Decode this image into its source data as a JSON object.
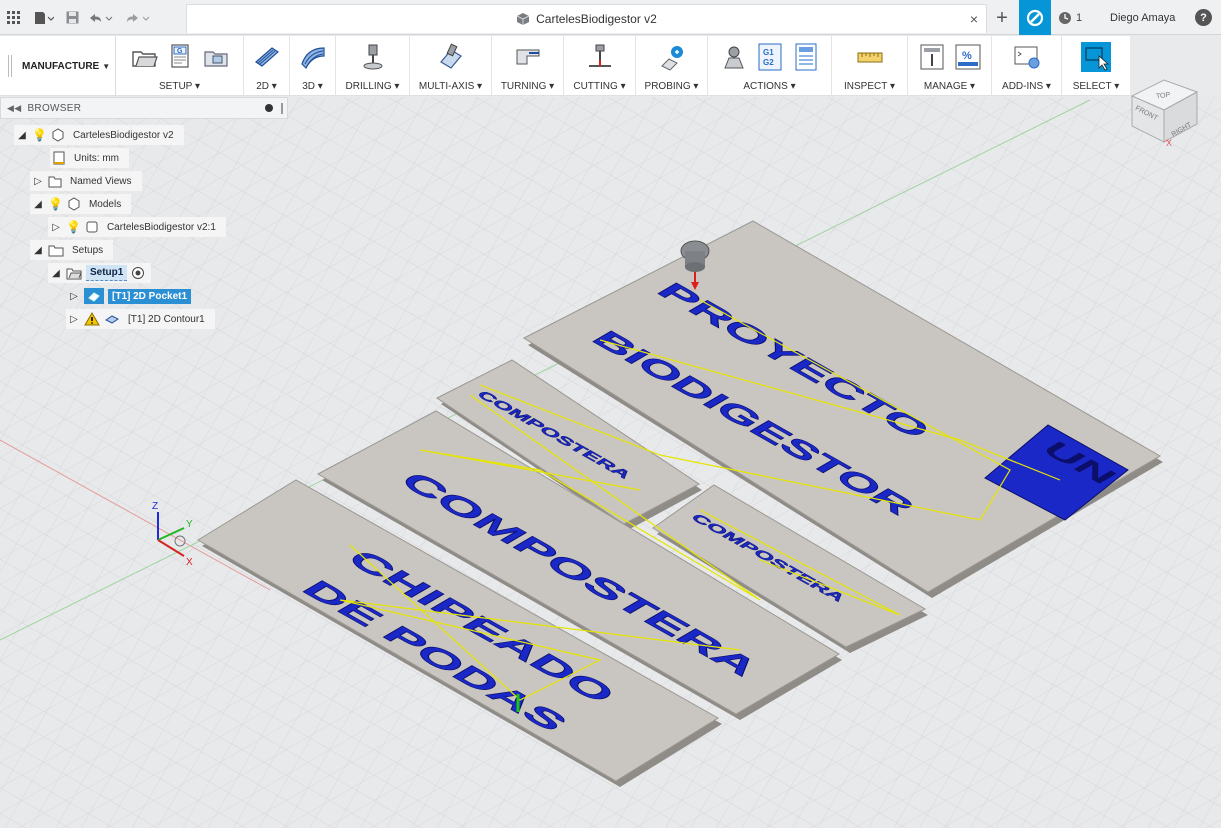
{
  "titlebar": {
    "doc_title": "CartelesBiodigestor v2",
    "close": "×",
    "new_tab": "+",
    "jobs_count": "1",
    "user": "Diego Amaya",
    "help": "?"
  },
  "toolbar": {
    "workspace": "MANUFACTURE",
    "groups": [
      {
        "label": "SETUP"
      },
      {
        "label": "2D"
      },
      {
        "label": "3D"
      },
      {
        "label": "DRILLING"
      },
      {
        "label": "MULTI-AXIS"
      },
      {
        "label": "TURNING"
      },
      {
        "label": "CUTTING"
      },
      {
        "label": "PROBING"
      },
      {
        "label": "ACTIONS"
      },
      {
        "label": "INSPECT"
      },
      {
        "label": "MANAGE"
      },
      {
        "label": "ADD-INS"
      },
      {
        "label": "SELECT"
      }
    ],
    "g_icon_text": "G",
    "g1": "G1",
    "g2": "G2",
    "percent": "%"
  },
  "browser": {
    "title": "BROWSER",
    "nodes": [
      {
        "label": "CartelesBiodigestor v2"
      },
      {
        "label": "Units: mm"
      },
      {
        "label": "Named Views"
      },
      {
        "label": "Models"
      },
      {
        "label": "CartelesBiodigestor v2:1"
      },
      {
        "label": "Setups"
      },
      {
        "label": "Setup1"
      },
      {
        "label": "[T1] 2D Pocket1"
      },
      {
        "label": "[T1] 2D Contour1"
      }
    ]
  },
  "viewcube": {
    "top": "TOP",
    "front": "FRONT",
    "right": "RIGHT",
    "axis_x": "X"
  },
  "triad": {
    "z": "Z",
    "y": "Y",
    "x": "X"
  },
  "signs": {
    "big_line1": "PROYECTO",
    "big_line2": "BIODIGESTOR",
    "logo": "UN",
    "compostera": "COMPOSTERA",
    "chipeado_line1": "CHIPEADO",
    "chipeado_line2": "DE PODAS"
  },
  "colors": {
    "accent": "#0696d7",
    "plate_fill": "#c9c5c0",
    "engrave": "#1b28c8",
    "toolpath": "#e6e600",
    "selected": "#2b8fd3"
  }
}
